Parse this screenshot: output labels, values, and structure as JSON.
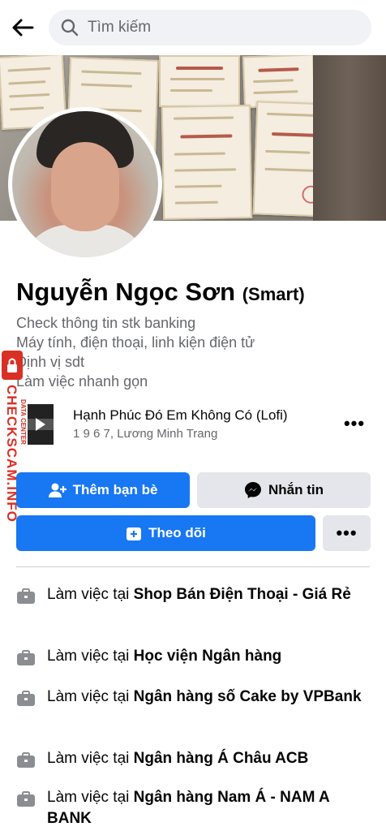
{
  "search": {
    "placeholder": "Tìm kiếm"
  },
  "profile": {
    "name": "Nguyễn Ngọc Sơn",
    "alt_name": "(Smart)",
    "bio": [
      "Check thông tin stk banking",
      "Máy tính, điện thoại, linh kiện điện tử",
      "Định vị sdt",
      "Làm việc nhanh gọn"
    ]
  },
  "music": {
    "title": "Hạnh Phúc Đó Em Không Có (Lofi)",
    "artist": "1 9 6 7, Lương Minh Trang"
  },
  "actions": {
    "add_friend": "Thêm bạn bè",
    "message": "Nhắn tin",
    "follow": "Theo dõi",
    "more": "•••"
  },
  "work": [
    {
      "prefix": "Làm việc tại ",
      "place": "Shop Bán Điện Thoại  - Giá Rẻ"
    },
    {
      "prefix": "Làm việc tại ",
      "place": "Học viện Ngân hàng"
    },
    {
      "prefix": "Làm việc tại ",
      "place": "Ngân hàng số Cake by VPBank"
    },
    {
      "prefix": "Làm việc tại ",
      "place": "Ngân hàng Á Châu ACB"
    },
    {
      "prefix": "Làm việc tại ",
      "place": "Ngân hàng Nam Á - NAM A BANK"
    }
  ],
  "watermark": {
    "text": "CHECKSCAM.INFO",
    "sub": "DATA CENTER"
  },
  "colors": {
    "primary": "#1877f2",
    "grey_button": "#e4e6eb",
    "secondary_text": "#65676b",
    "watermark": "#d93025"
  }
}
